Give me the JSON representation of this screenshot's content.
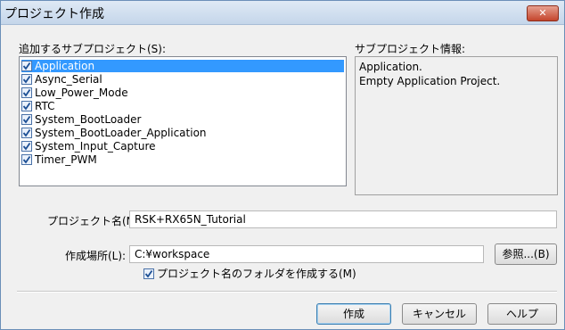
{
  "window": {
    "title": "プロジェクト作成",
    "close_label": "✕"
  },
  "subprojects": {
    "label": "追加するサブプロジェクト(S):",
    "items": [
      {
        "label": "Application",
        "checked": true,
        "selected": true
      },
      {
        "label": "Async_Serial",
        "checked": true
      },
      {
        "label": "Low_Power_Mode",
        "checked": true
      },
      {
        "label": "RTC",
        "checked": true
      },
      {
        "label": "System_BootLoader",
        "checked": true
      },
      {
        "label": "System_BootLoader_Application",
        "checked": true
      },
      {
        "label": "System_Input_Capture",
        "checked": true
      },
      {
        "label": "Timer_PWM",
        "checked": true
      }
    ]
  },
  "info": {
    "label": "サブプロジェクト情報:",
    "lines": [
      "Application.",
      "Empty Application Project."
    ]
  },
  "project_name": {
    "label": "プロジェクト名(N):",
    "value": "RSK+RX65N_Tutorial"
  },
  "location": {
    "label": "作成場所(L):",
    "value": "C:¥workspace",
    "browse_label": "参照...(B)"
  },
  "create_folder": {
    "label": "プロジェクト名のフォルダを作成する(M)",
    "checked": true
  },
  "buttons": {
    "create": "作成",
    "cancel": "キャンセル",
    "help": "ヘルプ"
  },
  "colors": {
    "selection": "#3399ff",
    "close": "#c4452c"
  }
}
